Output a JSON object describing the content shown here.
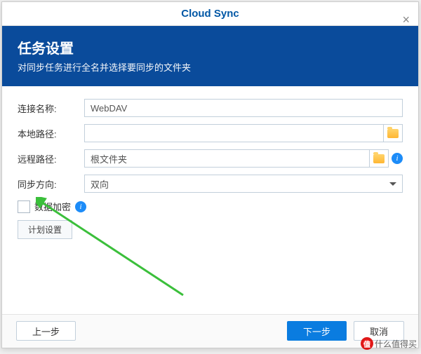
{
  "title": "Cloud Sync",
  "header": {
    "title": "任务设置",
    "subtitle": "对同步任务进行全名并选择要同步的文件夹"
  },
  "form": {
    "connName": {
      "label": "连接名称:",
      "value": "WebDAV"
    },
    "localPath": {
      "label": "本地路径:",
      "value": ""
    },
    "remotePath": {
      "label": "远程路径:",
      "value": "根文件夹"
    },
    "syncDir": {
      "label": "同步方向:",
      "value": "双向"
    },
    "encrypt": {
      "label": "数据加密"
    },
    "scheduleBtn": "计划设置"
  },
  "buttons": {
    "back": "上一步",
    "next": "下一步",
    "cancel": "取消"
  },
  "watermark": {
    "logo": "值",
    "text": "什么值得买"
  }
}
